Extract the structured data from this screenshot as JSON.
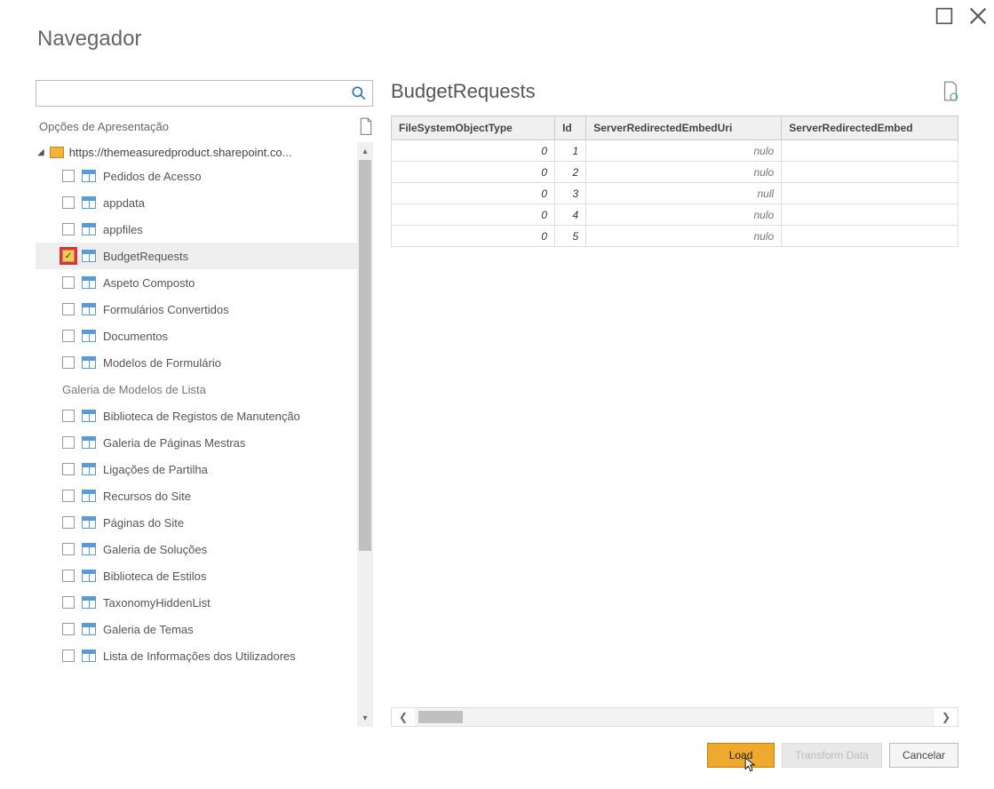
{
  "window": {
    "title": "Navegador"
  },
  "search": {
    "placeholder": ""
  },
  "displayOptions": {
    "label": "Opções de Apresentação"
  },
  "tree": {
    "root": {
      "label": "https://themeasuredproduct.sharepoint.co..."
    },
    "items": [
      {
        "label": "Pedidos de Acesso",
        "checked": false
      },
      {
        "label": "appdata",
        "checked": false
      },
      {
        "label": "appfiles",
        "checked": false
      },
      {
        "label": "BudgetRequests",
        "checked": true,
        "selected": true,
        "highlight": true
      },
      {
        "label": "Aspeto Composto",
        "checked": false
      },
      {
        "label": "Formulários Convertidos",
        "checked": false
      },
      {
        "label": "Documentos",
        "checked": false
      },
      {
        "label": "Modelos de Formulário",
        "checked": false
      },
      {
        "label": "Galeria de Modelos de Lista",
        "section": true
      },
      {
        "label": "Biblioteca de Registos de Manutenção",
        "checked": false
      },
      {
        "label": "Galeria de Páginas Mestras",
        "checked": false
      },
      {
        "label": "Ligações de Partilha",
        "checked": false
      },
      {
        "label": "Recursos do Site",
        "checked": false
      },
      {
        "label": "Páginas do Site",
        "checked": false
      },
      {
        "label": "Galeria de Soluções",
        "checked": false
      },
      {
        "label": "Biblioteca de Estilos",
        "checked": false
      },
      {
        "label": "TaxonomyHiddenList",
        "checked": false
      },
      {
        "label": "Galeria de Temas",
        "checked": false
      },
      {
        "label": "Lista de Informações dos Utilizadores",
        "checked": false
      }
    ]
  },
  "preview": {
    "title": "BudgetRequests",
    "columns": [
      "FileSystemObjectType",
      "Id",
      "ServerRedirectedEmbedUri",
      "ServerRedirectedEmbed"
    ],
    "rows": [
      {
        "fsot": "0",
        "id": "1",
        "uri": "nulo"
      },
      {
        "fsot": "0",
        "id": "2",
        "uri": "nulo"
      },
      {
        "fsot": "0",
        "id": "3",
        "uri": "null"
      },
      {
        "fsot": "0",
        "id": "4",
        "uri": "nulo"
      },
      {
        "fsot": "0",
        "id": "5",
        "uri": "nulo"
      }
    ]
  },
  "buttons": {
    "load": "Load",
    "transform": "Transform Data",
    "cancel": "Cancelar"
  }
}
